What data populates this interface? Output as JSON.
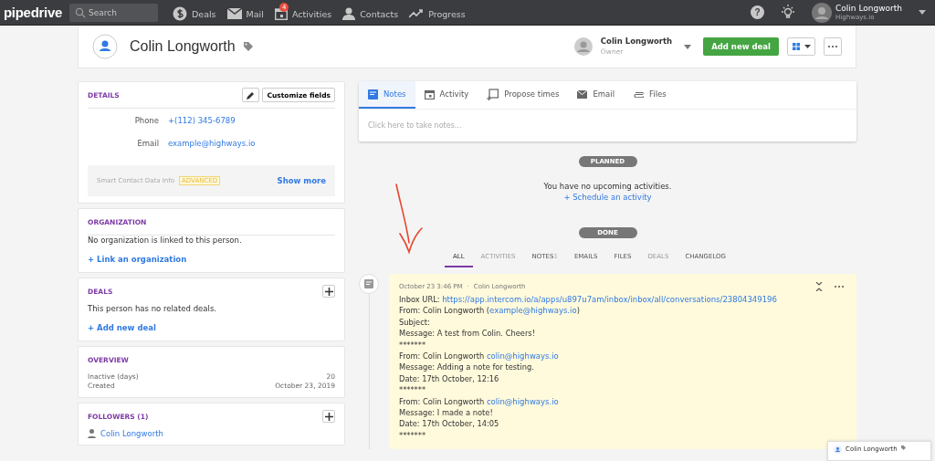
{
  "topbar": {
    "logo": "pipedrive",
    "search": {
      "placeholder": "Search"
    },
    "nav": [
      {
        "kind": "deals",
        "label": "Deals"
      },
      {
        "kind": "mail",
        "label": "Mail"
      },
      {
        "kind": "activities",
        "label": "Activities",
        "badge": "4"
      },
      {
        "kind": "contacts",
        "label": "Contacts"
      },
      {
        "kind": "progress",
        "label": "Progress"
      }
    ],
    "help": "?",
    "user": {
      "name": "Colin Longworth",
      "company": "Highways.io"
    }
  },
  "header": {
    "name": "Colin Longworth",
    "owner": {
      "name": "Colin Longworth",
      "role": "Owner"
    },
    "add_button": "Add new deal"
  },
  "details": {
    "title": "DETAILS",
    "customize": "Customize fields",
    "fields": [
      {
        "label": "Phone",
        "value": "+(112) 345-6789"
      },
      {
        "label": "Email",
        "value": "example@highways.io"
      }
    ],
    "smart": {
      "label": "Smart Contact Data Info",
      "badge": "ADVANCED",
      "link": "Show more"
    }
  },
  "organization": {
    "title": "ORGANIZATION",
    "text": "No organization is linked to this person.",
    "link": "+ Link an organization"
  },
  "deals": {
    "title": "DEALS",
    "text": "This person has no related deals.",
    "link": "+ Add new deal"
  },
  "overview": {
    "title": "OVERVIEW",
    "rows": [
      {
        "label": "Inactive (days)",
        "value": "20"
      },
      {
        "label": "Created",
        "value": "October 23, 2019"
      }
    ]
  },
  "followers": {
    "title": "FOLLOWERS (1)",
    "items": [
      "Colin Longworth"
    ]
  },
  "composer": {
    "tabs": [
      {
        "kind": "notes",
        "label": "Notes",
        "selected": true
      },
      {
        "kind": "activity",
        "label": "Activity",
        "selected": false
      },
      {
        "kind": "propose",
        "label": "Propose times",
        "selected": false
      },
      {
        "kind": "email",
        "label": "Email",
        "selected": false
      },
      {
        "kind": "files",
        "label": "Files",
        "selected": false
      }
    ],
    "placeholder": "Click here to take notes..."
  },
  "planned": {
    "label": "PLANNED",
    "text": "You have no upcoming activities.",
    "link": "+ Schedule an activity"
  },
  "done": {
    "label": "DONE"
  },
  "filters": [
    {
      "label": "ALL",
      "selected": true,
      "disabled": false
    },
    {
      "label": "ACTIVITIES",
      "selected": false,
      "disabled": true
    },
    {
      "label": "NOTES",
      "count": "1",
      "selected": false,
      "disabled": false
    },
    {
      "label": "EMAILS",
      "selected": false,
      "disabled": false
    },
    {
      "label": "FILES",
      "selected": false,
      "disabled": false
    },
    {
      "label": "DEALS",
      "selected": false,
      "disabled": true
    },
    {
      "label": "CHANGELOG",
      "selected": false,
      "disabled": false
    }
  ],
  "note": {
    "date": "October 23 3:46 PM",
    "separator": "·",
    "author": "Colin Longworth",
    "lines": [
      [
        {
          "kind": "text",
          "text": "Inbox URL: "
        },
        {
          "kind": "link",
          "text": "https://app.intercom.io/a/apps/u897u7am/inbox/inbox/all/conversations/23804349196"
        }
      ],
      [
        {
          "kind": "text",
          "text": "From: Colin Longworth ("
        },
        {
          "kind": "link",
          "text": "example@highways.io"
        },
        {
          "kind": "text",
          "text": ")"
        }
      ],
      [
        {
          "kind": "text",
          "text": "Subject:"
        }
      ],
      [
        {
          "kind": "text",
          "text": "Message: A test from Colin. Cheers!"
        }
      ],
      [
        {
          "kind": "text",
          "text": "*******"
        }
      ],
      [
        {
          "kind": "text",
          "text": "From: Colin Longworth "
        },
        {
          "kind": "link",
          "text": "colin@highways.io"
        }
      ],
      [
        {
          "kind": "text",
          "text": "Message: Adding a note for testing."
        }
      ],
      [
        {
          "kind": "text",
          "text": "Date: 17th October, 12:16"
        }
      ],
      [
        {
          "kind": "text",
          "text": "*******"
        }
      ],
      [
        {
          "kind": "text",
          "text": "From: Colin Longworth "
        },
        {
          "kind": "link",
          "text": "colin@highways.io"
        }
      ],
      [
        {
          "kind": "text",
          "text": "Message: I made a note!"
        }
      ],
      [
        {
          "kind": "text",
          "text": "Date: 17th October, 14:05"
        }
      ],
      [
        {
          "kind": "text",
          "text": "*******"
        }
      ]
    ]
  },
  "mini_window": {
    "name": "Colin Longworth"
  }
}
